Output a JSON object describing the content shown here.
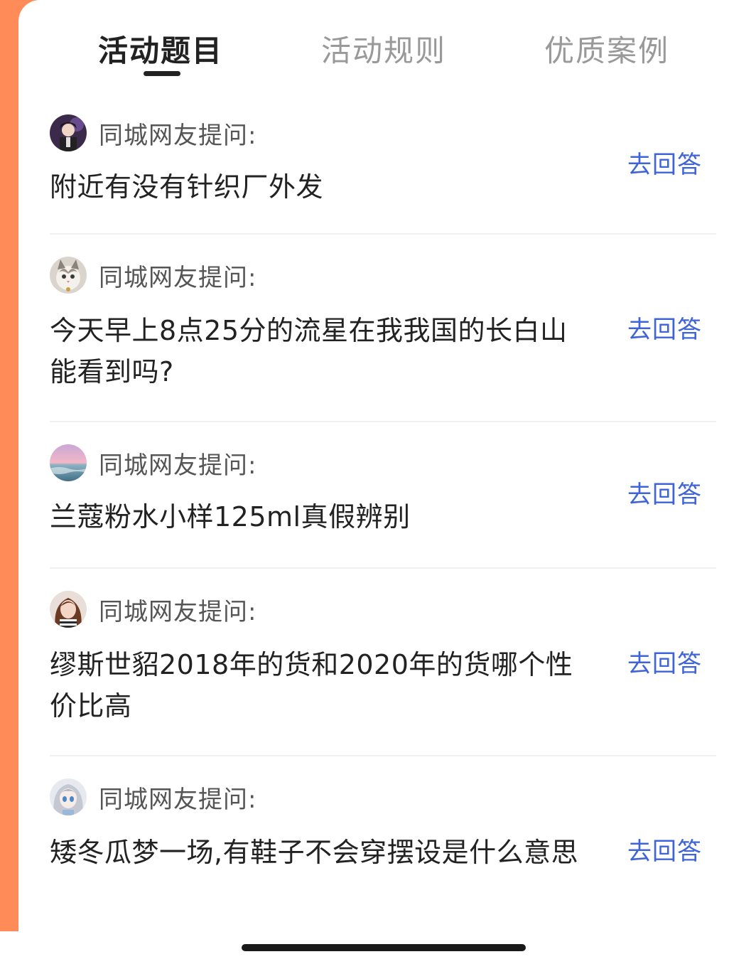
{
  "tabs": [
    {
      "label": "活动题目",
      "active": true
    },
    {
      "label": "活动规则",
      "active": false
    },
    {
      "label": "优质案例",
      "active": false
    }
  ],
  "colors": {
    "accent": "#FF8C58",
    "link": "#3E64D8",
    "text_primary": "#222222",
    "text_muted": "#999999"
  },
  "questions": [
    {
      "asker": "同城网友提问:",
      "text": "附近有没有针织厂外发",
      "action": "去回答",
      "avatar": "anime-boy-avatar"
    },
    {
      "asker": "同城网友提问:",
      "text": "今天早上8点25分的流星在我我国的长白山能看到吗?",
      "action": "去回答",
      "avatar": "cat-avatar"
    },
    {
      "asker": "同城网友提问:",
      "text": "兰蔻粉水小样125ml真假辨别",
      "action": "去回答",
      "avatar": "sunset-sea-avatar"
    },
    {
      "asker": "同城网友提问:",
      "text": "缪斯世貂2018年的货和2020年的货哪个性价比高",
      "action": "去回答",
      "avatar": "woman-avatar"
    },
    {
      "asker": "同城网友提问:",
      "text": "矮冬瓜梦一场,有鞋子不会穿摆设是什么意思",
      "action": "去回答",
      "avatar": "anime-girl-avatar"
    }
  ]
}
